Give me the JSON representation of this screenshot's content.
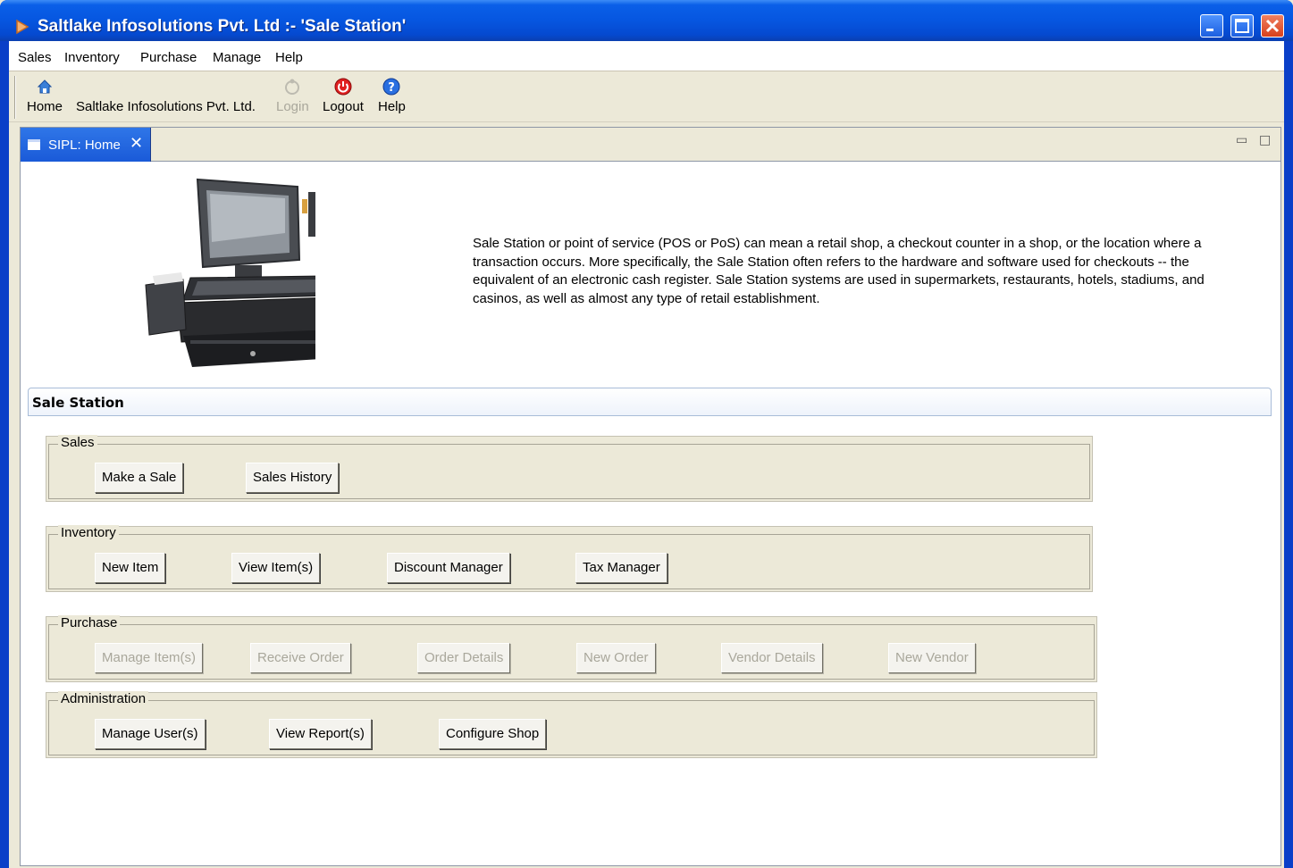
{
  "window": {
    "title": "Saltlake Infosolutions Pvt. Ltd :- 'Sale Station'",
    "controls": [
      "minimize",
      "maximize",
      "close"
    ]
  },
  "menubar": {
    "items": [
      "Sales",
      "Inventory",
      "Purchase",
      "Manage",
      "Help"
    ]
  },
  "toolbar": {
    "buttons": [
      {
        "label": "Home",
        "icon": "home-icon",
        "enabled": true
      },
      {
        "label": "Saltlake Infosolutions Pvt. Ltd.",
        "icon": "",
        "enabled": true
      },
      {
        "label": "Login",
        "icon": "login-icon",
        "enabled": false
      },
      {
        "label": "Logout",
        "icon": "power-icon",
        "enabled": true
      },
      {
        "label": "Help",
        "icon": "help-icon",
        "enabled": true
      }
    ]
  },
  "tab": {
    "label": "SIPL: Home",
    "close": "✕"
  },
  "main": {
    "description": "Sale Station or point of service (POS or PoS) can mean a retail shop, a checkout counter in a shop, or the location where a transaction occurs. More specifically, the Sale Station often refers to the hardware and software used for checkouts -- the equivalent of an electronic cash register. Sale Station systems are used in supermarkets, restaurants, hotels, stadiums, and casinos, as well as almost any type of retail establishment.",
    "section_title": "Sale Station",
    "groups": [
      {
        "label": "Sales",
        "buttons": [
          {
            "label": "Make a Sale",
            "enabled": true
          },
          {
            "label": "Sales History",
            "enabled": true
          }
        ]
      },
      {
        "label": "Inventory",
        "buttons": [
          {
            "label": "New Item",
            "enabled": true
          },
          {
            "label": "View Item(s)",
            "enabled": true
          },
          {
            "label": "Discount Manager",
            "enabled": true
          },
          {
            "label": "Tax Manager",
            "enabled": true
          }
        ]
      },
      {
        "label": "Purchase",
        "buttons": [
          {
            "label": "Manage Item(s)",
            "enabled": false
          },
          {
            "label": "Receive Order",
            "enabled": false
          },
          {
            "label": "Order Details",
            "enabled": false
          },
          {
            "label": "New Order",
            "enabled": false
          },
          {
            "label": "Vendor Details",
            "enabled": false
          },
          {
            "label": "New Vendor",
            "enabled": false
          }
        ]
      },
      {
        "label": "Administration",
        "buttons": [
          {
            "label": "Manage User(s)",
            "enabled": true
          },
          {
            "label": "View Report(s)",
            "enabled": true
          },
          {
            "label": "Configure Shop",
            "enabled": true
          }
        ]
      }
    ]
  },
  "colors": {
    "titlebar": "#0656e0",
    "tab_active": "#2f76e8",
    "panel": "#ece9d8"
  }
}
